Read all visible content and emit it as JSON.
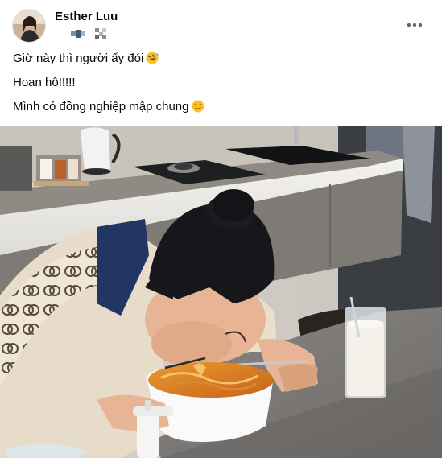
{
  "post": {
    "author": {
      "name": "Esther Luu"
    },
    "lines": [
      {
        "text": "Giờ này thì người ấy đói",
        "emoji": "rolling-laughing-emoji"
      },
      {
        "text": "Hoan hô!!!!!",
        "emoji": ""
      },
      {
        "text": "Mình có đồng nghiệp mập chung",
        "emoji": "smirk-emoji"
      }
    ],
    "photo": {
      "subject": "photo"
    }
  },
  "colors": {
    "text": "#050505",
    "secondary": "#65676b",
    "emoji_yellow": "#fcc21b"
  }
}
